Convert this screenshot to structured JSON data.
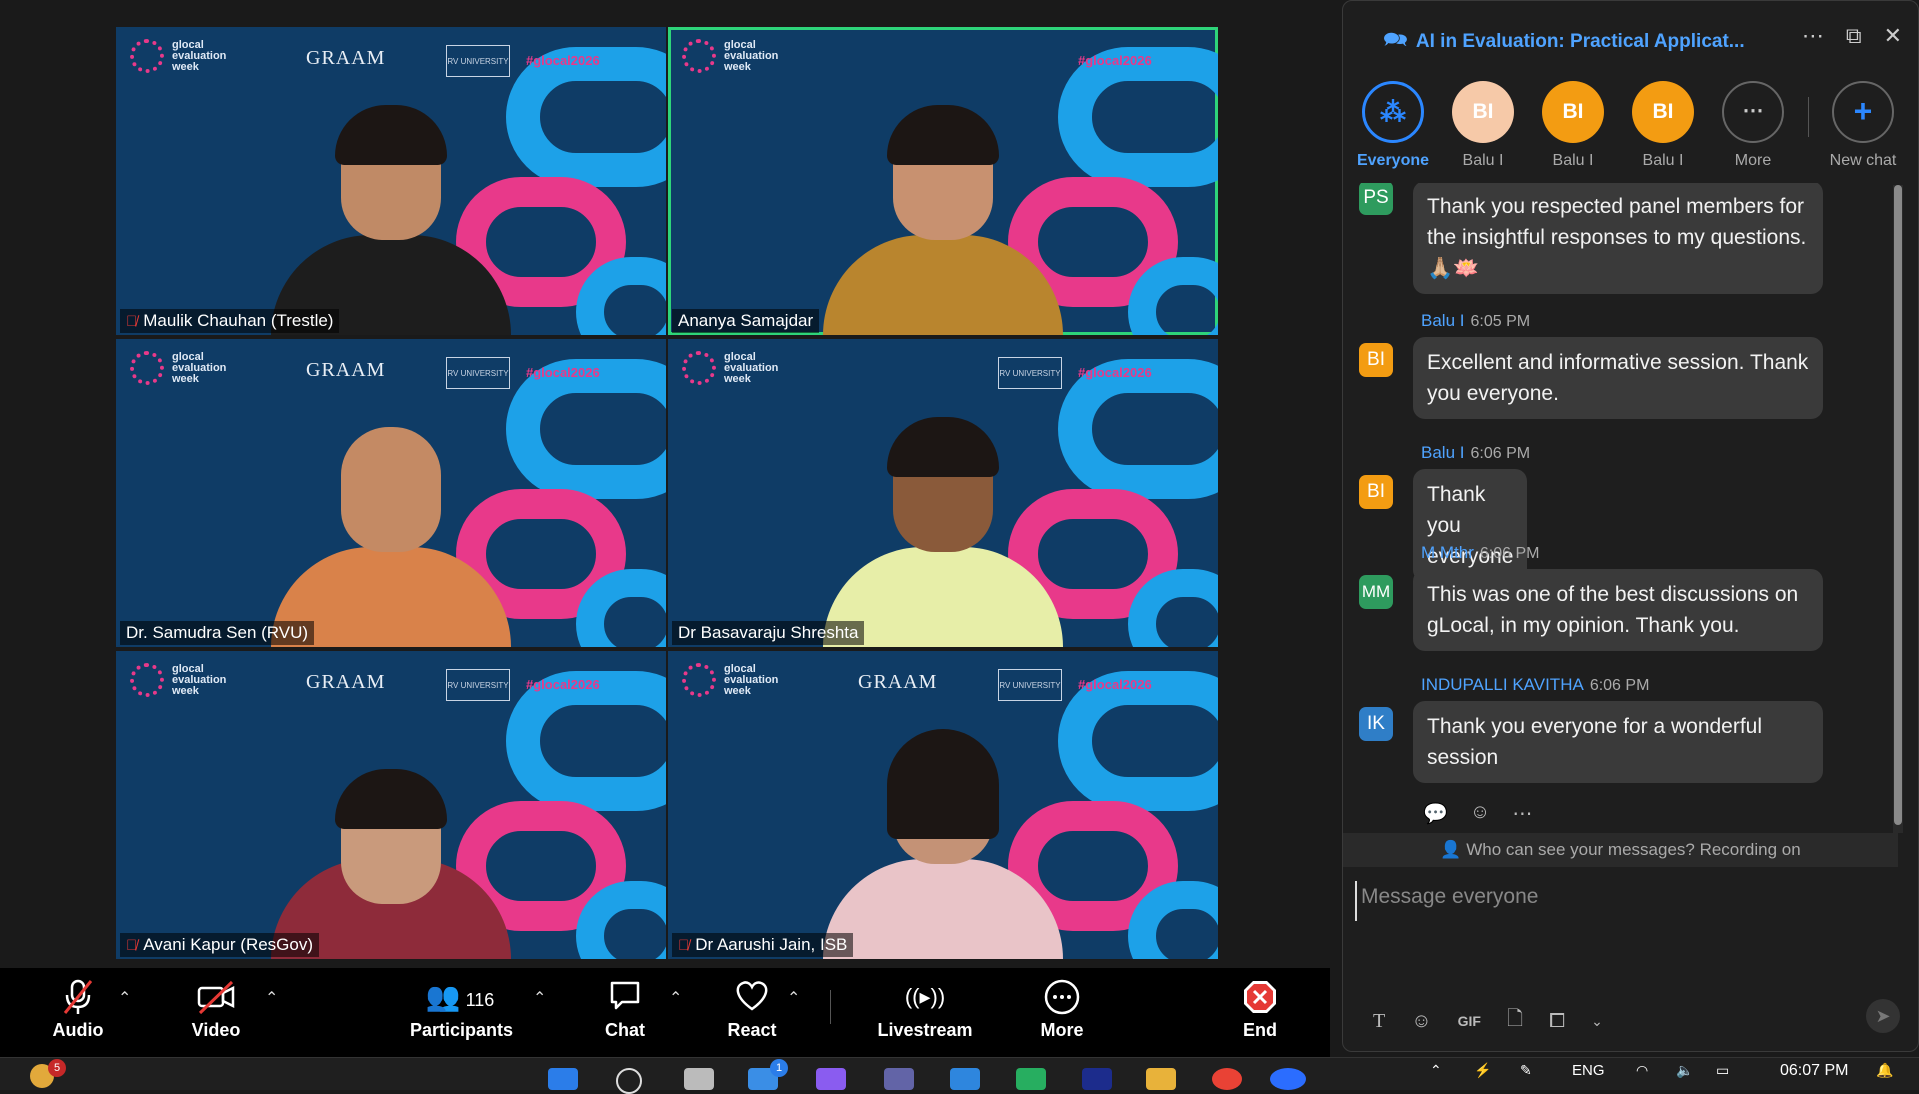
{
  "tiles": [
    {
      "name": "Maulik Chauhan (Trestle)",
      "muted": true
    },
    {
      "name": "Ananya Samajdar",
      "muted": false
    },
    {
      "name": "Dr. Samudra Sen (RVU)",
      "muted": false
    },
    {
      "name": "Dr Basavaraju Shreshta",
      "muted": false
    },
    {
      "name": "Avani Kapur (ResGov)",
      "muted": true
    },
    {
      "name": "Dr Aarushi Jain, ISB",
      "muted": true
    }
  ],
  "tile_branding": {
    "logo_line1": "glocal",
    "logo_line2": "evaluation",
    "logo_line3": "week",
    "graam": "GRAAM",
    "rv": "RV UNIVERSITY",
    "hashtag": "#glocal2026"
  },
  "toolbar": {
    "audio": "Audio",
    "video": "Video",
    "participants": "Participants",
    "participants_count": "116",
    "chat": "Chat",
    "react": "React",
    "livestream": "Livestream",
    "more": "More",
    "end": "End"
  },
  "chat": {
    "title": "AI in Evaluation: Practical Applicat...",
    "recipients": [
      {
        "initials": "",
        "label": "Everyone",
        "selected": true
      },
      {
        "initials": "BI",
        "label": "Balu I"
      },
      {
        "initials": "BI",
        "label": "Balu I"
      },
      {
        "initials": "BI",
        "label": "Balu I"
      },
      {
        "initials": "",
        "label": "More"
      },
      {
        "initials": "",
        "label": "New chat"
      }
    ],
    "messages": [
      {
        "initials": "PS",
        "sender": "",
        "time": "",
        "text": "Thank you respected panel members for the insightful responses to my questions.🙏🏼🪷"
      },
      {
        "initials": "BI",
        "sender": "Balu I",
        "time": "6:05 PM",
        "text": "Excellent and informative session. Thank you everyone."
      },
      {
        "initials": "BI",
        "sender": "Balu I",
        "time": "6:06 PM",
        "text": "Thank you everyone"
      },
      {
        "initials": "MM",
        "sender": "M Mthr",
        "time": "6:06 PM",
        "text": "This was one of the best discussions on gLocal, in my opinion. Thank you."
      },
      {
        "initials": "IK",
        "sender": "INDUPALLI KAVITHA",
        "time": "6:06 PM",
        "text": "Thank you everyone for a wonderful session"
      }
    ],
    "notice": "Who can see your messages? Recording on",
    "placeholder": "Message everyone"
  },
  "taskbar": {
    "notification_count": "5",
    "mail_count": "1",
    "lang": "ENG",
    "time": "06:07 PM"
  },
  "colors": {
    "accent": "#4fa3ff",
    "active_border": "#2ed47a",
    "avatar_orange": "#f39c12",
    "avatar_green": "#2e9b5e",
    "avatar_blue": "#2f7ec7",
    "end_red": "#e53935"
  }
}
